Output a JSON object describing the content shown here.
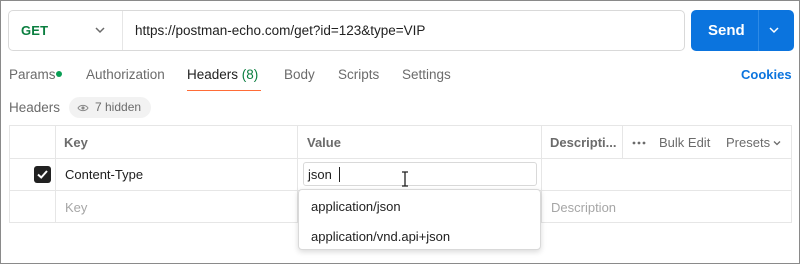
{
  "request": {
    "method": "GET",
    "url": "https://postman-echo.com/get?id=123&type=VIP",
    "send_label": "Send"
  },
  "tabs": [
    {
      "label": "Params",
      "has_dot": true
    },
    {
      "label": "Authorization"
    },
    {
      "label": "Headers",
      "count": "(8)",
      "active": true
    },
    {
      "label": "Body"
    },
    {
      "label": "Scripts"
    },
    {
      "label": "Settings"
    }
  ],
  "cookies_label": "Cookies",
  "headers_section": {
    "title": "Headers",
    "hidden_label": "7 hidden"
  },
  "table": {
    "columns": {
      "key": "Key",
      "value": "Value",
      "description": "Descripti...",
      "bulk_edit": "Bulk Edit",
      "presets": "Presets"
    },
    "rows": [
      {
        "checked": true,
        "key": "Content-Type",
        "value": "json"
      }
    ],
    "new_row": {
      "key_placeholder": "Key",
      "description_placeholder": "Description"
    }
  },
  "autocomplete": {
    "options": [
      "application/json",
      "application/vnd.api+json"
    ]
  },
  "colors": {
    "accent": "#0b74de",
    "method_green": "#0a7e3f",
    "tab_underline": "#ff6c37"
  }
}
